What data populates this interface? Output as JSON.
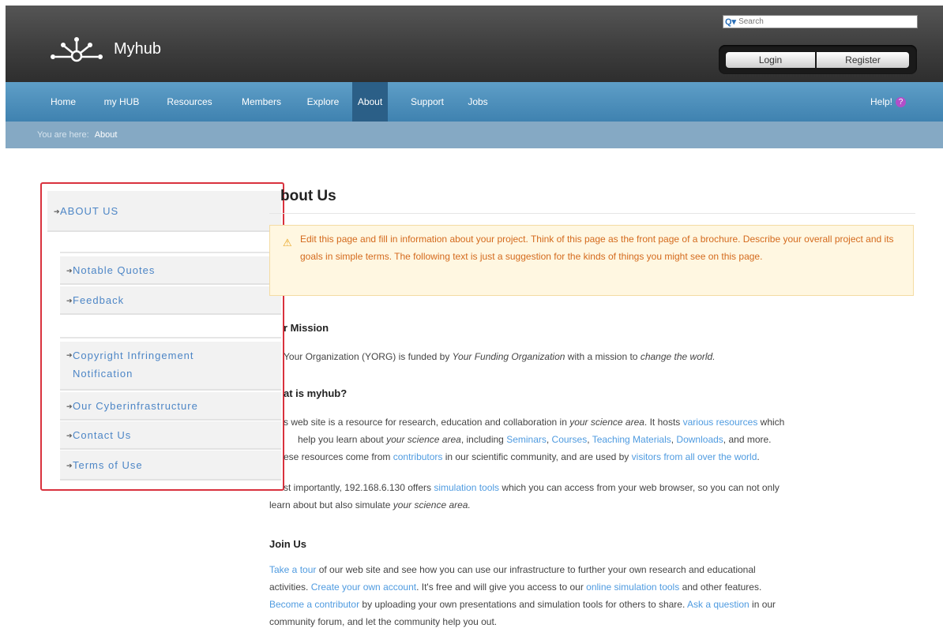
{
  "header": {
    "site_name": "Myhub",
    "search_placeholder": "Search",
    "login_label": "Login",
    "register_label": "Register"
  },
  "nav": {
    "items": [
      "Home",
      "my HUB",
      "Resources",
      "Members",
      "Explore",
      "About",
      "Support",
      "Jobs"
    ],
    "active": "About",
    "help_label": "Help!"
  },
  "breadcrumb": {
    "prefix": "You are here:",
    "current": "About"
  },
  "sidebar": {
    "items": [
      "ABOUT US",
      "Notable Quotes",
      "Feedback",
      "Copyright Infringement",
      "Notification",
      "Our Cyberinfrastructure",
      "Contact Us",
      "Terms of Use"
    ]
  },
  "main": {
    "title": "bout Us",
    "notice": "Edit this page and fill in information about your project. Think of this page as the front page of a brochure. Describe your overall project and its goals in simple terms. The following text is just a suggestion for the kinds of things you might see on this page.",
    "mission_heading": "r Mission",
    "mission_text_1": "Your Organization (YORG) is funded by ",
    "mission_funding_org": "Your Funding Organization",
    "mission_text_2": " with a mission to ",
    "mission_goal": "change the world.",
    "what_heading": "at is myhub?",
    "what_p1_1": "s web site is a resource for research, education and collaboration in ",
    "science_area": "your science area",
    "what_p1_2": ". It hosts ",
    "link_various_resources": "various resources",
    "what_p1_3": " which",
    "what_p1_4": "help you learn about ",
    "what_p1_5": ", including ",
    "link_seminars": "Seminars",
    "link_courses": "Courses",
    "link_teaching": "Teaching Materials",
    "link_downloads": "Downloads",
    "what_p1_6": ", and more.",
    "what_p1_7": "ese resources come from ",
    "link_contributors": "contributors",
    "what_p1_8": " in our scientific community, and are used by ",
    "link_visitors": "visitors from all over the world",
    "what_p2_1": "st importantly, 192.168.6.130 offers ",
    "link_simulation_tools": "simulation tools",
    "what_p2_2": " which you can access from your web browser, so you can not only",
    "what_p2_3": "learn about but also simulate ",
    "science_area_end": "your science area.",
    "join_heading": "Join Us",
    "link_tour": "Take a tour",
    "join_1": " of our web site and see how you can use our infrastructure to further your own research and educational",
    "join_2": "activities. ",
    "link_create_account": "Create your own account",
    "join_3": ". It's free and will give you access to our ",
    "link_online_tools": "online simulation tools",
    "join_4": " and other features.",
    "link_become_contributor": "Become a contributor",
    "join_5": " by uploading your own presentations and simulation tools for others to share. ",
    "link_ask_question": "Ask a question",
    "join_6": " in our",
    "join_7": "community forum, and let the community help you out."
  }
}
